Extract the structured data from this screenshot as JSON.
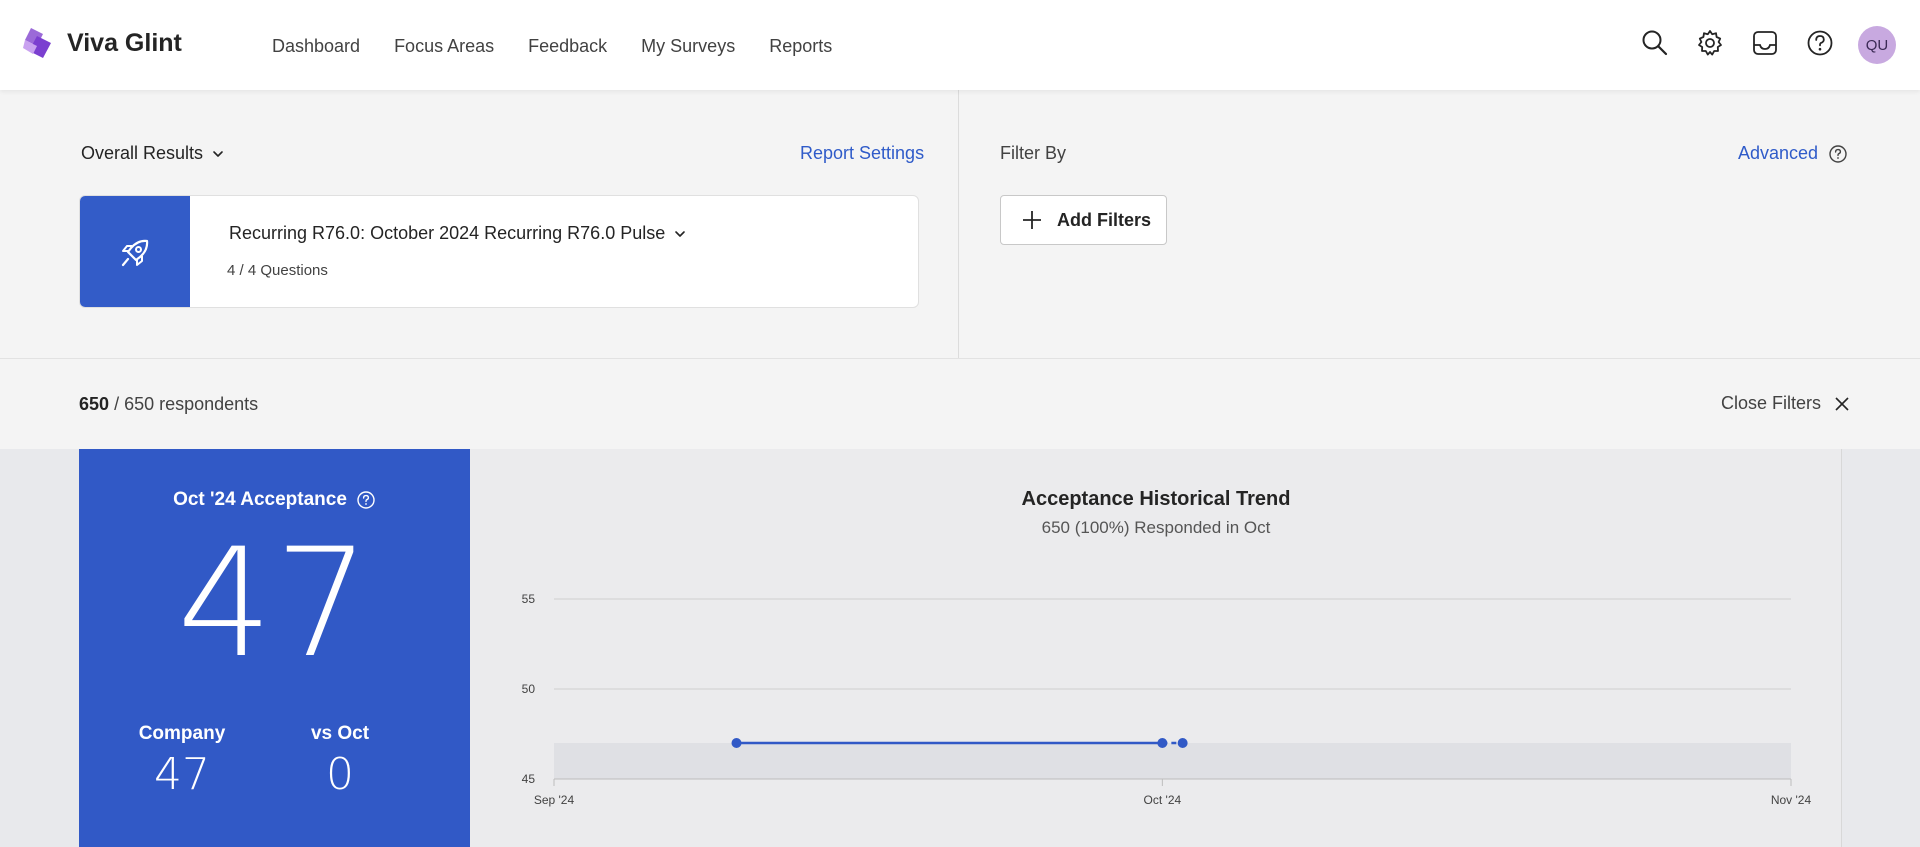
{
  "app": {
    "name": "Viva Glint",
    "logo_icon": "viva-glint-logo-icon"
  },
  "nav": {
    "items": [
      "Dashboard",
      "Focus Areas",
      "Feedback",
      "My Surveys",
      "Reports"
    ]
  },
  "header_icons": [
    "search-icon",
    "gear-icon",
    "inbox-icon",
    "help-icon"
  ],
  "user": {
    "initials": "QU"
  },
  "report": {
    "view_label": "Overall Results",
    "settings_label": "Report Settings",
    "survey_title": "Recurring R76.0:  October 2024 Recurring R76.0 Pulse",
    "survey_questions": "4 / 4 Questions",
    "survey_icon": "rocket-icon"
  },
  "filters": {
    "label": "Filter By",
    "advanced_label": "Advanced",
    "add_label": "Add Filters",
    "close_label": "Close Filters"
  },
  "respondents": {
    "count": "650",
    "total": "/ 650 respondents"
  },
  "score": {
    "title": "Oct '24 Acceptance",
    "value": "47",
    "company_label": "Company",
    "company_value": "47",
    "vs_label": "vs Oct",
    "vs_value": "0"
  },
  "colors": {
    "accent": "#3159c6",
    "link": "#2f5bc9"
  },
  "chart_data": {
    "type": "line",
    "title": "Acceptance Historical Trend",
    "subtitle": "650 (100%) Responded in Oct",
    "x_ticks": [
      "Sep '24",
      "Oct '24",
      "Nov '24"
    ],
    "y_ticks": [
      45,
      50,
      55
    ],
    "ylim": [
      45,
      55
    ],
    "grid": true,
    "band": [
      45,
      47
    ],
    "series": [
      {
        "points": [
          {
            "x": "2024-09-10",
            "y": 47
          },
          {
            "x": "2024-10-01",
            "y": 47
          }
        ],
        "style": "solid"
      },
      {
        "points": [
          {
            "x": "2024-10-01",
            "y": 47
          },
          {
            "x": "2024-10-02",
            "y": 47
          }
        ],
        "style": "dashed"
      }
    ]
  }
}
